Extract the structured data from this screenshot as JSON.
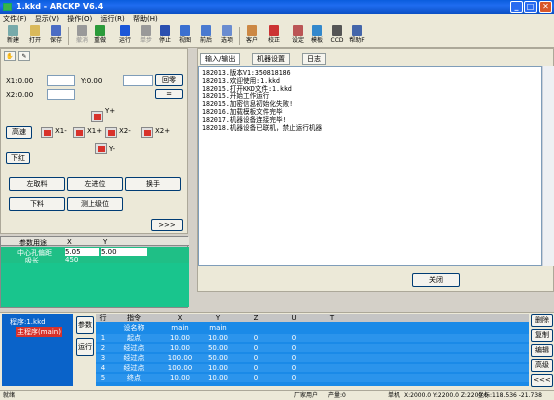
{
  "window": {
    "title": "1.kkd - ARCKP V6.4"
  },
  "menu": [
    "文件(F)",
    "显示(V)",
    "操作(O)",
    "运行(R)",
    "帮助(H)"
  ],
  "toolbar": [
    {
      "label": "新建",
      "icon": "new-file-icon",
      "disabled": false
    },
    {
      "label": "打开",
      "icon": "open-folder-icon",
      "disabled": false
    },
    {
      "label": "保存",
      "icon": "save-icon",
      "disabled": false
    },
    {
      "label": "撤消",
      "icon": "undo-icon",
      "disabled": true
    },
    {
      "label": "重做",
      "icon": "redo-icon",
      "disabled": false
    },
    {
      "label": "运行",
      "icon": "play-icon",
      "disabled": false
    },
    {
      "label": "单步",
      "icon": "step-icon",
      "disabled": true
    },
    {
      "label": "停止",
      "icon": "stop-icon",
      "disabled": false
    },
    {
      "label": "视图",
      "icon": "view-icon",
      "disabled": false
    },
    {
      "label": "前后",
      "icon": "zoom-icon",
      "disabled": false
    },
    {
      "label": "选项",
      "icon": "options-icon",
      "disabled": false
    },
    {
      "label": "客户",
      "icon": "client-icon",
      "disabled": false
    },
    {
      "label": "校正",
      "icon": "calibrate-icon",
      "disabled": false
    },
    {
      "label": "设定",
      "icon": "settings-icon",
      "disabled": false
    },
    {
      "label": "模板",
      "icon": "template-icon",
      "disabled": false
    },
    {
      "label": "CCD",
      "icon": "ccd-icon",
      "disabled": false
    },
    {
      "label": "帮助F",
      "icon": "help-icon",
      "disabled": false
    }
  ],
  "position": {
    "x1_label": "X1:0.00",
    "y_label": "Y:0.00",
    "x2_label": "X2:0.00",
    "return_zero": "回零",
    "equals": "="
  },
  "jog": {
    "y_plus": "Y+",
    "y_minus": "Y-",
    "x1_minus": "X1-",
    "x1_plus": "X1+",
    "x2_minus": "X2-",
    "x2_plus": "X2+",
    "high_speed": "高速",
    "lower": "下红"
  },
  "actions": {
    "left_hole": "左取料",
    "left_advance": "左进位",
    "switch": "换手",
    "unload": "下料",
    "measure": "测上级位",
    "more": ">>>"
  },
  "params": {
    "headers": [
      "参数用途",
      "X",
      "Y"
    ],
    "rows": [
      {
        "name": "中心孔偏距",
        "x": "5.05",
        "y": "5.00"
      },
      {
        "name": "吸长",
        "x": "450",
        "y": ""
      }
    ]
  },
  "right_tabs": [
    "输入/输出",
    "机器设置",
    "日志"
  ],
  "log_lines": [
    "182013.版本V1:350818186",
    "182013.欢迎使用:1.kkd",
    "182015.打开KKD文件:1.kkd",
    "182015.开始工作运行",
    "182015.加密信息初始化失败!",
    "182016.加载模板文件完毕",
    "182017.机器设备连接完毕!",
    "182018.机器设备已联机，禁止运行机器"
  ],
  "close_button": "关闭",
  "tree": {
    "root": "程序:1.kkd",
    "child": "主程序(main)"
  },
  "side_buttons": [
    "参数",
    "运行"
  ],
  "program_table": {
    "headers": [
      "行",
      "指令",
      "X",
      "Y",
      "Z",
      "U",
      "T"
    ],
    "rows": [
      {
        "n": "",
        "cmd": "设名称",
        "x": "main",
        "y": "main",
        "z": "",
        "u": "",
        "t": ""
      },
      {
        "n": "1",
        "cmd": "起点",
        "x": "10.00",
        "y": "10.00",
        "z": "0",
        "u": "0",
        "t": ""
      },
      {
        "n": "2",
        "cmd": "经过点",
        "x": "10.00",
        "y": "50.00",
        "z": "0",
        "u": "0",
        "t": ""
      },
      {
        "n": "3",
        "cmd": "经过点",
        "x": "100.00",
        "y": "50.00",
        "z": "0",
        "u": "0",
        "t": ""
      },
      {
        "n": "4",
        "cmd": "经过点",
        "x": "100.00",
        "y": "10.00",
        "z": "0",
        "u": "0",
        "t": ""
      },
      {
        "n": "5",
        "cmd": "终点",
        "x": "10.00",
        "y": "10.00",
        "z": "0",
        "u": "0",
        "t": ""
      }
    ]
  },
  "right_buttons": [
    "删除",
    "复制",
    "编辑",
    "高级",
    "<<<"
  ],
  "status": {
    "left": "就绪",
    "mid1": "厂家用户",
    "mid2": "产量:0",
    "right1": "单机",
    "right2": "X:2000.0 Y:2200.0 Z:2200.0",
    "right3": "坐标:118.536 -21.738"
  }
}
